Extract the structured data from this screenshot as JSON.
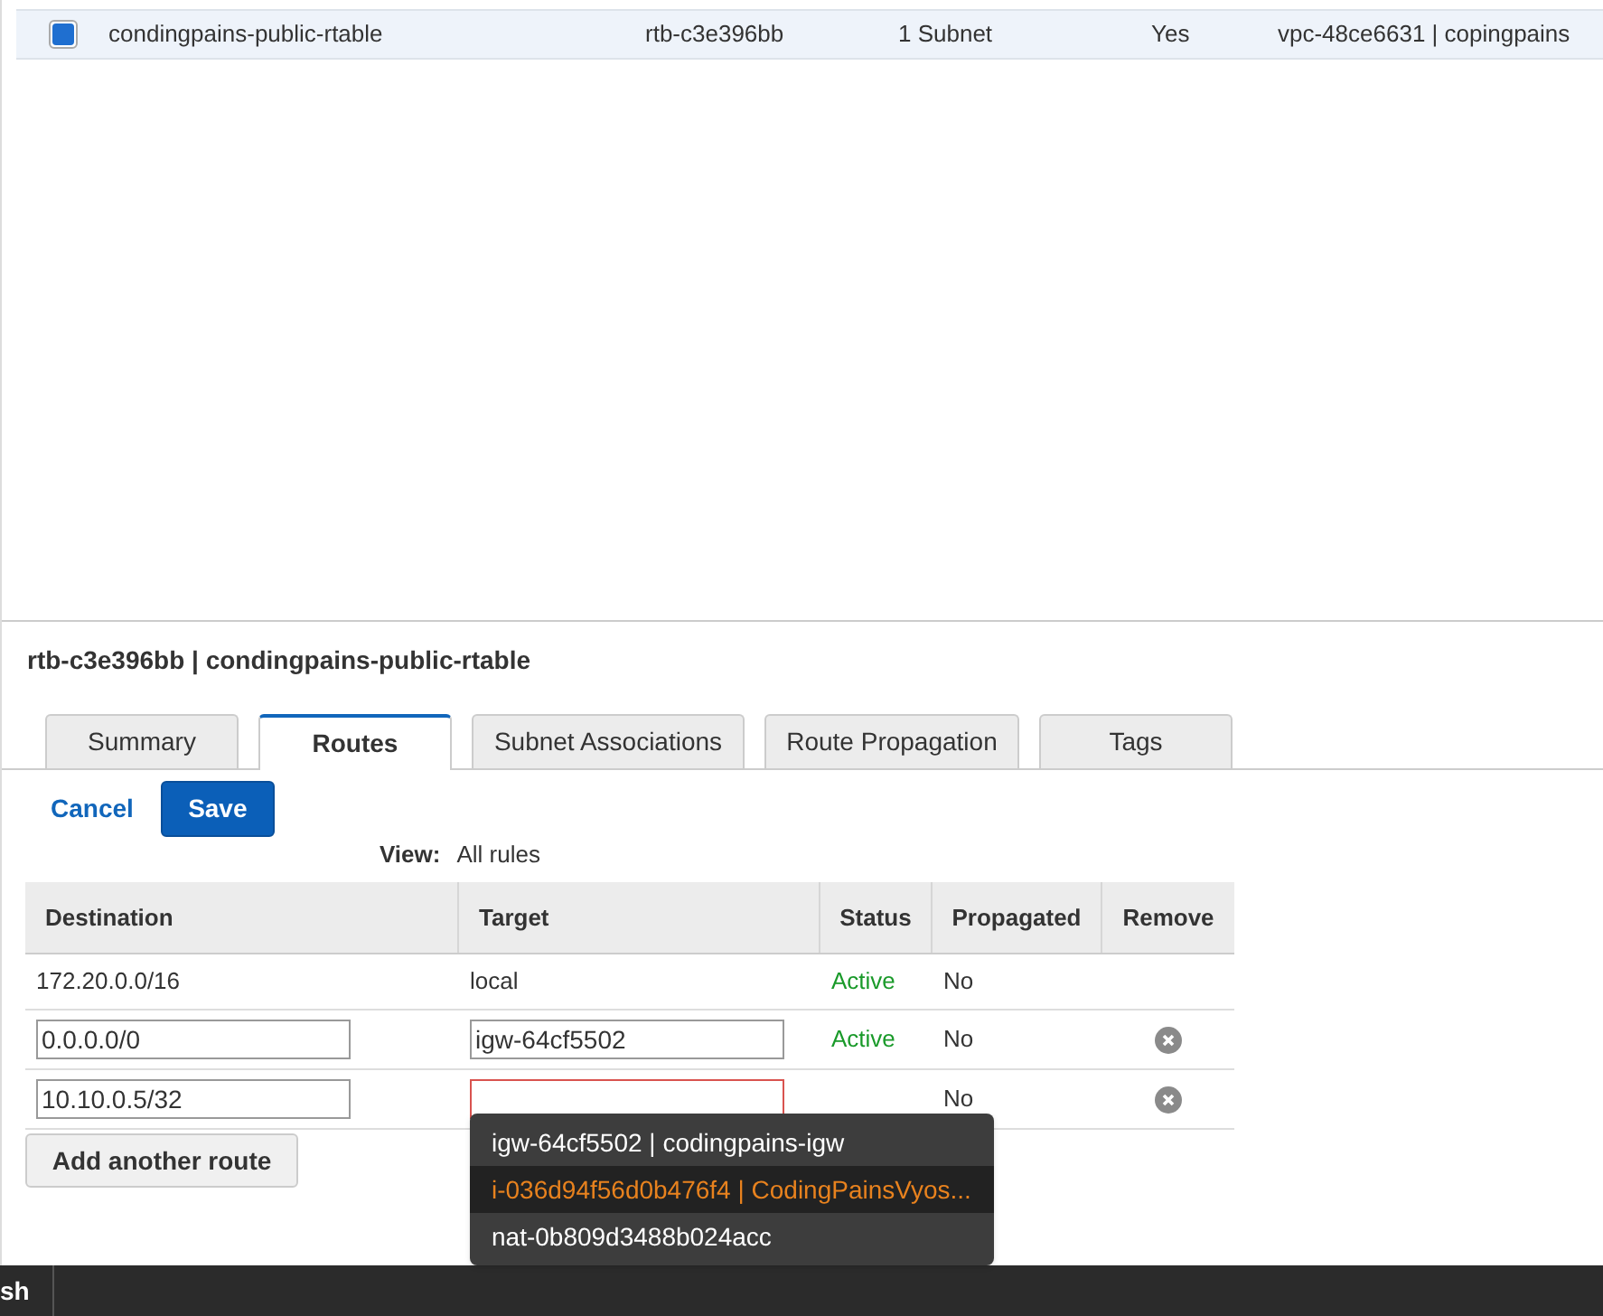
{
  "route_tables": {
    "rows": [
      {
        "selected": true,
        "cells": [
          "condingpains-public-rtable",
          "rtb-c3e396bb",
          "1 Subnet",
          "Yes",
          "vpc-48ce6631 | copingpains"
        ]
      }
    ]
  },
  "details": {
    "title": "rtb-c3e396bb | condingpains-public-rtable",
    "tabs": [
      {
        "label": "Summary",
        "selected": false
      },
      {
        "label": "Routes",
        "selected": true
      },
      {
        "label": "Subnet Associations",
        "selected": false
      },
      {
        "label": "Route Propagation",
        "selected": false
      },
      {
        "label": "Tags",
        "selected": false
      }
    ],
    "cancel": "Cancel",
    "save": "Save",
    "view": {
      "label": "View:",
      "value": "All rules"
    },
    "routes": {
      "columns": [
        "Destination",
        "Target",
        "Status",
        "Propagated",
        "Remove"
      ],
      "rows": [
        {
          "kind": "static",
          "destination": "172.20.0.0/16",
          "target": "local",
          "status": "Active",
          "propagated": "No",
          "removable": false
        },
        {
          "kind": "editable",
          "destination": "0.0.0.0/0",
          "target": "igw-64cf5502",
          "status": "Active",
          "propagated": "No",
          "removable": true,
          "target_invalid": false
        },
        {
          "kind": "editable",
          "destination": "10.10.0.5/32",
          "target": "",
          "propagated": "No",
          "removable": true,
          "target_invalid": true
        }
      ]
    },
    "add_route": "Add another route",
    "dropdown": {
      "items": [
        {
          "label": "igw-64cf5502 | codingpains-igw",
          "selected": false
        },
        {
          "label": "i-036d94f56d0b476f4 | CodingPainsVyos...",
          "selected": true
        },
        {
          "label": "nat-0b809d3488b024acc",
          "selected": false
        }
      ]
    }
  },
  "taskbar": {
    "label": "sh"
  }
}
